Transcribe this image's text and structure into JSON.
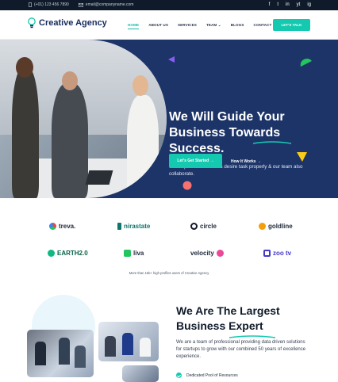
{
  "topbar": {
    "phone": "(+01) 123 456 7890",
    "email": "email@companyname.com",
    "socials": [
      "f",
      "t",
      "in",
      "yt",
      "ig"
    ]
  },
  "header": {
    "brand": "Creative Agency",
    "nav": [
      "HOME",
      "ABOUT US",
      "SERVICES",
      "TEAM",
      "BLOGS",
      "CONTACT US"
    ],
    "active_nav": "HOME",
    "cta": "LET'S TALK"
  },
  "hero": {
    "title_line1": "We Will Guide Your",
    "title_line2": "Business Towards",
    "title_line3": "Success.",
    "subtitle": "We help to create clients desire task properly & our team also collaborate.",
    "btn_start": "Let's Get Started →",
    "btn_how": "How It Works →",
    "accent": "#14c9b0",
    "background": "#1d3468"
  },
  "brands": {
    "row1": [
      "treva.",
      "nirastate",
      "circle",
      "goldline"
    ],
    "row2": [
      "EARTH2.0",
      "liva",
      "velocity",
      "zoo tv"
    ],
    "note": "More than 15k+ high profiles users of Creative Agency"
  },
  "about": {
    "title_line1": "We Are The Largest",
    "title_line2": "Business Expert",
    "description": "We are a team of professional providing data driven solutions for startups to grow with our combined 50 years of excellence experience.",
    "feature1": "Dedicated Pool of Resources"
  }
}
